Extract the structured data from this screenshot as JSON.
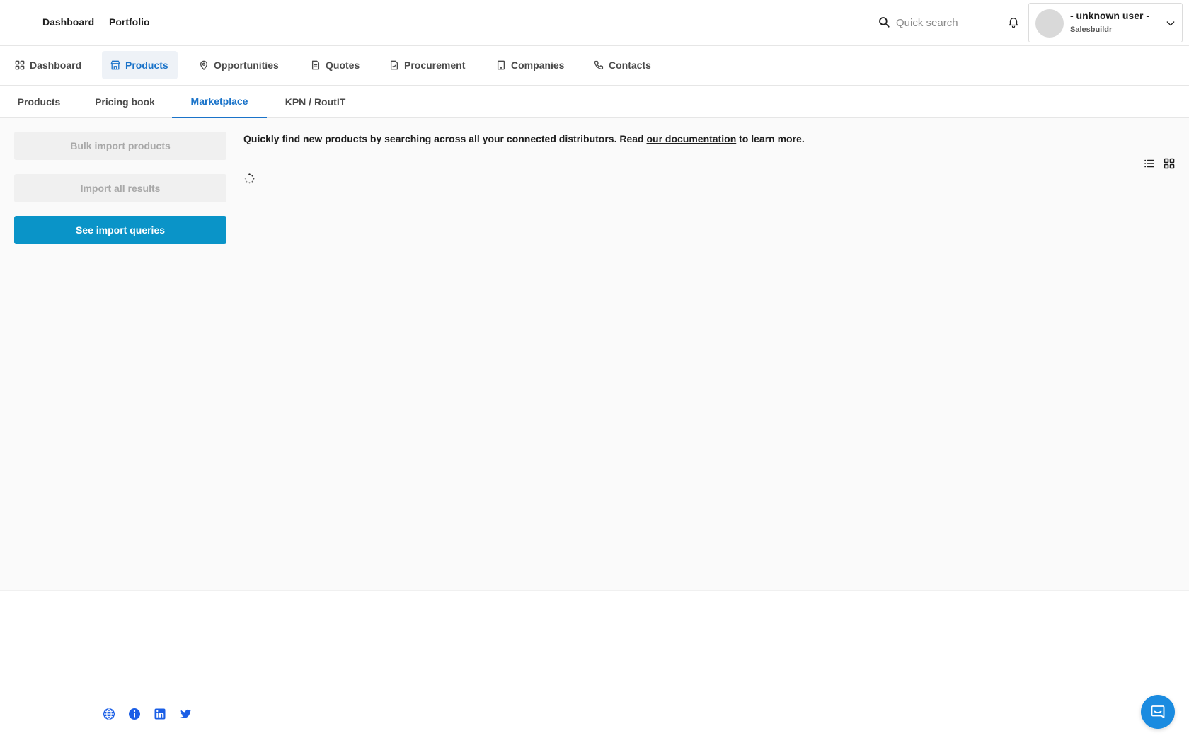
{
  "header": {
    "links": [
      "Dashboard",
      "Portfolio"
    ],
    "search_placeholder": "Quick search",
    "user": {
      "name": "- unknown user -",
      "org": "Salesbuildr"
    }
  },
  "main_nav": {
    "items": [
      {
        "label": "Dashboard",
        "icon": "grid-icon"
      },
      {
        "label": "Products",
        "icon": "store-icon",
        "active": true
      },
      {
        "label": "Opportunities",
        "icon": "pin-icon"
      },
      {
        "label": "Quotes",
        "icon": "document-icon"
      },
      {
        "label": "Procurement",
        "icon": "file-check-icon"
      },
      {
        "label": "Companies",
        "icon": "building-icon"
      },
      {
        "label": "Contacts",
        "icon": "phone-icon"
      }
    ]
  },
  "sub_tabs": {
    "items": [
      "Products",
      "Pricing book",
      "Marketplace",
      "KPN / RoutIT"
    ],
    "active": "Marketplace"
  },
  "sidebar": {
    "bulk_import": "Bulk import products",
    "import_all": "Import all results",
    "see_queries": "See import queries"
  },
  "content": {
    "intro_before": "Quickly find new products by searching across all your connected distributors. Read ",
    "intro_link": "our documentation",
    "intro_after": " to learn more."
  },
  "colors": {
    "accent": "#1a73c9",
    "primary_button": "#0a94c8",
    "social_icons": "#1a5ee6",
    "chat_button": "#1a8be0"
  },
  "footer": {
    "icons": [
      "globe-icon",
      "info-icon",
      "linkedin-icon",
      "twitter-icon"
    ]
  }
}
